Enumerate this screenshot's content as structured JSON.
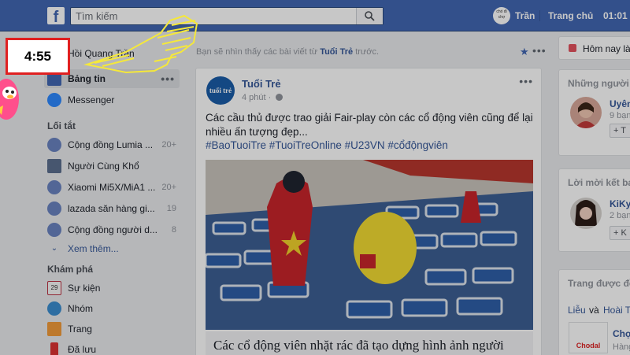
{
  "topbar": {
    "logo": "f",
    "search_placeholder": "Tìm kiếm",
    "avatar_text": "chó đi chợ",
    "user_name": "Trần",
    "home_label": "Trang chủ",
    "time_text": "01:01"
  },
  "leftnav": {
    "profile_name": "Hồi Quang Trần",
    "items": [
      {
        "label": "Bảng tin"
      },
      {
        "label": "Messenger"
      }
    ],
    "shortcuts_heading": "Lối tắt",
    "shortcuts": [
      {
        "label": "Cộng đồng Lumia ...",
        "count": "20+",
        "icon": "group-icon"
      },
      {
        "label": "Người Cùng Khổ",
        "count": "",
        "icon": "shield-icon"
      },
      {
        "label": "Xiaomi Mi5X/MiA1 ...",
        "count": "20+",
        "icon": "group-icon"
      },
      {
        "label": "lazada săn hàng gi...",
        "count": "19",
        "icon": "group-icon"
      },
      {
        "label": "Cộng đồng người d...",
        "count": "8",
        "icon": "group-icon"
      }
    ],
    "see_more": "Xem thêm...",
    "explore_heading": "Khám phá",
    "explore": [
      {
        "label": "Sự kiện",
        "icon": "calendar-icon",
        "icon_text": "29"
      },
      {
        "label": "Nhóm",
        "icon": "people-icon"
      },
      {
        "label": "Trang",
        "icon": "flag-icon"
      },
      {
        "label": "Đã lưu",
        "icon": "bookmark-icon"
      }
    ]
  },
  "feed": {
    "hint_prefix": "Bạn sẽ nhìn thấy các bài viết từ ",
    "hint_source": "Tuổi Trẻ",
    "hint_suffix": " trước.",
    "post": {
      "logo_text": "tuổi trẻ",
      "author": "Tuổi Trẻ",
      "time": "4 phút ·",
      "text": "Các cầu thủ được trao giải Fair-play còn các cổ động viên cũng để lại nhiều ấn tượng đẹp...",
      "tags": "#BaoTuoiTre #TuoiTreOnline #U23VN #cổđộngviên",
      "headline": "Các cổ động viên nhặt rác đã tạo dựng hình ảnh người"
    }
  },
  "rightcol": {
    "reminder": "Hôm nay là",
    "people_title": "Những người",
    "person1": {
      "name": "Uyên",
      "sub": "9 bạn",
      "add": "+ T"
    },
    "requests_title": "Lời mời kết bạ",
    "person2": {
      "name": "KiKy",
      "sub": "2 bạn",
      "add": "+ K"
    },
    "pages_title": "Trang được đề",
    "pages_liked": "Liễu",
    "pages_and": "và",
    "pages_other": "Hoài T",
    "page_name": "Chợ",
    "page_sub": "Hàng",
    "page_logo": "Chodal"
  },
  "overlay": {
    "timer": "4:55"
  }
}
